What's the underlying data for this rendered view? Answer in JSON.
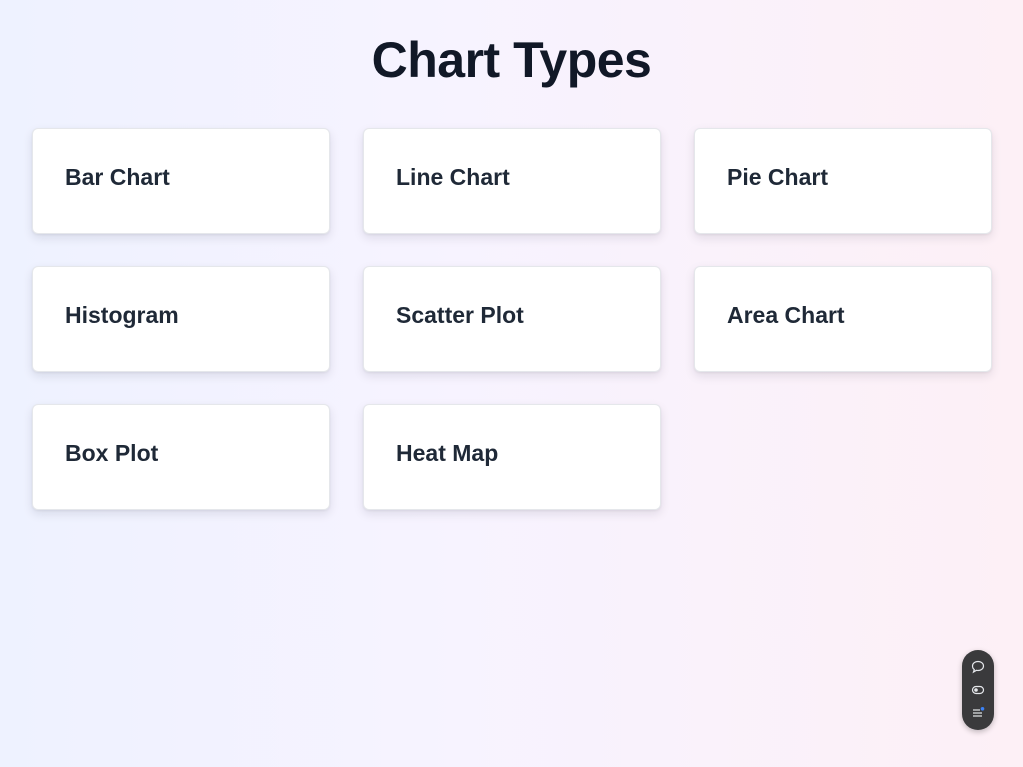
{
  "page": {
    "title": "Chart Types"
  },
  "cards": [
    {
      "label": "Bar Chart"
    },
    {
      "label": "Line Chart"
    },
    {
      "label": "Pie Chart"
    },
    {
      "label": "Histogram"
    },
    {
      "label": "Scatter Plot"
    },
    {
      "label": "Area Chart"
    },
    {
      "label": "Box Plot"
    },
    {
      "label": "Heat Map"
    }
  ],
  "toolbar": {
    "icons": [
      "chat-bubble-icon",
      "toggle-icon",
      "list-icon"
    ],
    "accent_color": "#3b82f6"
  },
  "colors": {
    "title": "#111827",
    "card_text": "#1f2937",
    "card_bg": "#ffffff"
  }
}
